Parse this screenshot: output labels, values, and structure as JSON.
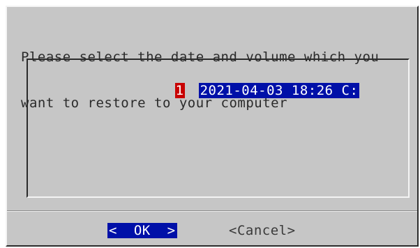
{
  "dialog": {
    "prompt_lines": [
      "Please select the date and volume which you",
      "want to restore to your computer"
    ],
    "list": {
      "items": [
        {
          "tag": "1",
          "label": "2021-04-03 18:26 C:"
        }
      ]
    },
    "buttons": {
      "ok_label": "<  OK  >",
      "cancel_label": "<Cancel>"
    }
  },
  "colors": {
    "dialog_background": "#c6c6c6",
    "selection_background": "#0010a8",
    "tag_background": "#c80000"
  }
}
